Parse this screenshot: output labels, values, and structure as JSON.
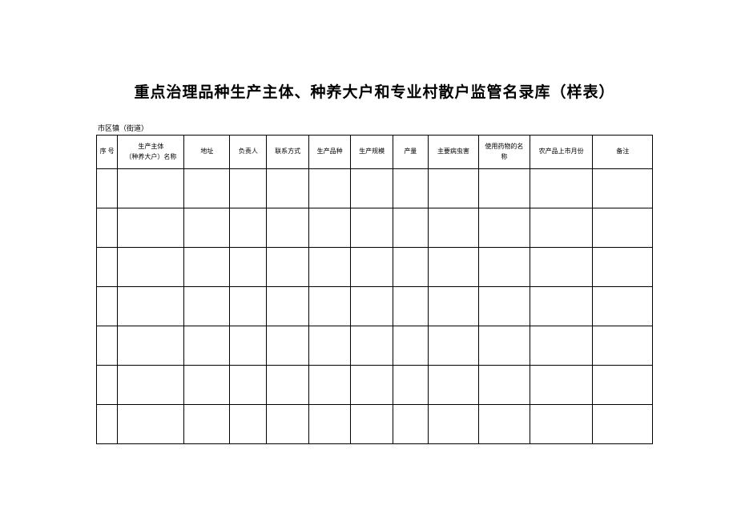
{
  "title": "重点治理品种生产主体、种养大户和专业村散户监管名录库（样表）",
  "subtitle": "市区镇（街道）",
  "headers": {
    "seq": "序 号",
    "entity_line1": "生产主体",
    "entity_line2": "（种养大户）名称",
    "addr": "地址",
    "person": "负责人",
    "contact": "联系方式",
    "variety": "生产品种",
    "scale": "生产规模",
    "output": "产量",
    "pest": "主要病虫害",
    "drug_line1": "使用药物的名",
    "drug_line2": "称",
    "month": "农产品上市月份",
    "remark": "备注"
  },
  "row_count": 7
}
